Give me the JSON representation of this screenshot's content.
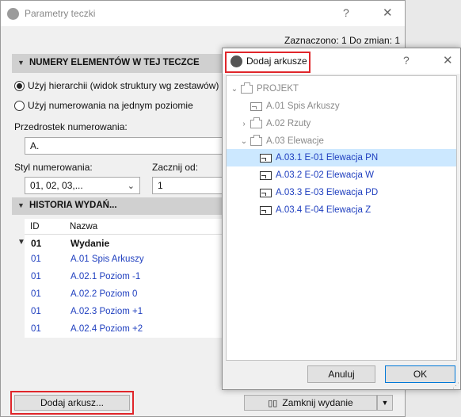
{
  "main": {
    "title": "Parametry teczki",
    "help": "?",
    "close": "✕",
    "status": "Zaznaczono: 1 Do zmian: 1",
    "section_numbering": "NUMERY ELEMENTÓW W TEJ TECZCE",
    "radio_hierarchy": "Użyj hierarchii (widok struktury wg zestawów)",
    "radio_single": "Użyj numerowania na jednym poziomie",
    "prefix_label": "Przedrostek numerowania:",
    "prefix_value": "A.",
    "style_label": "Styl numerowania:",
    "style_value": "01, 02, 03,...",
    "start_label": "Zacznij od:",
    "start_value": "1",
    "section_history": "HISTORIA WYDAŃ...",
    "table": {
      "col_id": "ID",
      "col_name": "Nazwa",
      "group": {
        "id": "01",
        "name": "Wydanie"
      },
      "rows": [
        {
          "id": "01",
          "name": "A.01 Spis Arkuszy"
        },
        {
          "id": "01",
          "name": "A.02.1 Poziom -1"
        },
        {
          "id": "01",
          "name": "A.02.2 Poziom 0"
        },
        {
          "id": "01",
          "name": "A.02.3 Poziom +1"
        },
        {
          "id": "01",
          "name": "A.02.4 Poziom +2"
        }
      ]
    },
    "add_sheet_button": "Dodaj arkusz...",
    "close_issue_button": "Zamknij wydanie"
  },
  "dialog": {
    "title": "Dodaj arkusze",
    "help": "?",
    "close": "✕",
    "tree": {
      "root": "PROJEKT",
      "spis": "A.01 Spis Arkuszy",
      "rzuty": "A.02 Rzuty",
      "elewacje": "A.03 Elewacje",
      "sheets": [
        "A.03.1 E-01 Elewacja PN",
        "A.03.2 E-02 Elewacja W",
        "A.03.3 E-03 Elewacja PD",
        "A.03.4 E-04 Elewacja Z"
      ]
    },
    "cancel": "Anuluj",
    "ok": "OK"
  },
  "colors": {
    "highlight_red": "#e0262b",
    "link_blue": "#1f3fbf",
    "selection": "#cce8ff"
  }
}
